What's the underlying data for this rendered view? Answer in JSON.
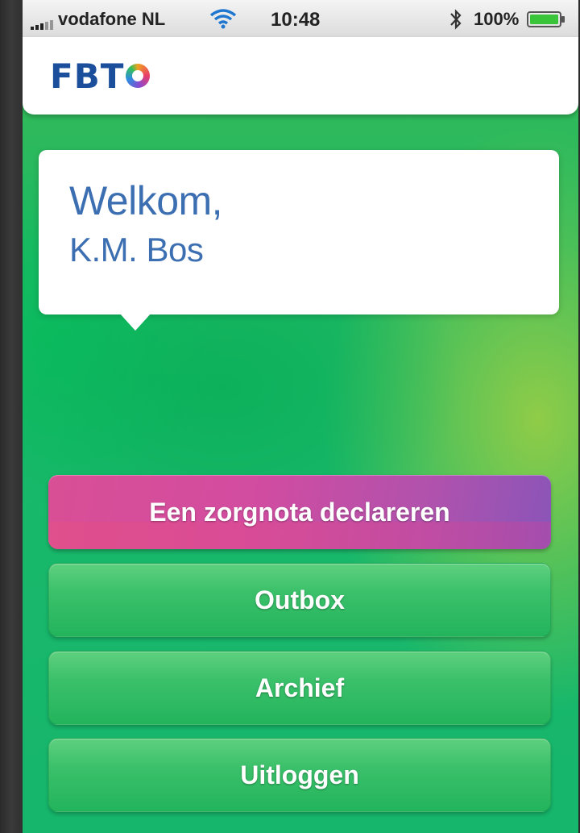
{
  "status_bar": {
    "carrier": "vodafone NL",
    "time": "10:48",
    "battery": "100%"
  },
  "header": {
    "logo_text": "FBT"
  },
  "welcome": {
    "greeting": "Welkom,",
    "name": "K.M. Bos"
  },
  "buttons": {
    "declare": "Een zorgnota declareren",
    "outbox": "Outbox",
    "archive": "Archief",
    "logout": "Uitloggen"
  },
  "colors": {
    "brand_blue": "#1b4f9c",
    "welcome_text": "#3c6fb1",
    "primary_button": "#d94f95",
    "background_green": "#19b86a"
  }
}
